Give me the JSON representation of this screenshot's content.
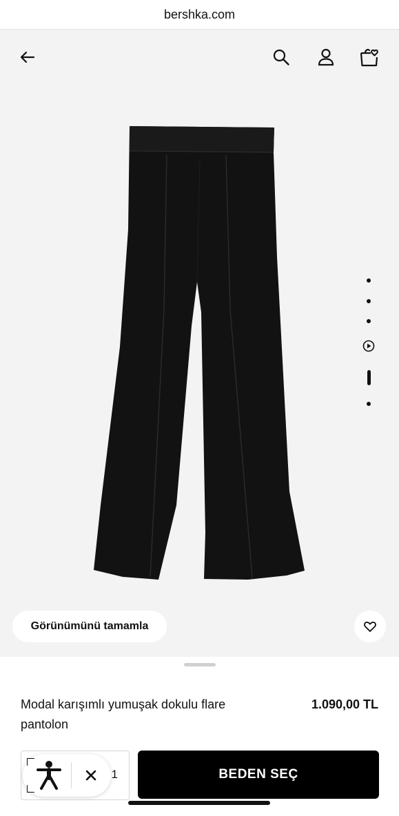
{
  "browser": {
    "url": "bershka.com"
  },
  "header": {
    "back_icon": "arrow-left-icon",
    "search_icon": "search-icon",
    "account_icon": "user-icon",
    "wishlist_bag_icon": "bag-heart-icon"
  },
  "gallery": {
    "image_count": 6,
    "active_index": 4,
    "has_video": true,
    "garment_color": "#121212"
  },
  "actions": {
    "complete_look_label": "Görünümünü tamamla",
    "favorite_icon": "heart-icon"
  },
  "product": {
    "name": "Modal karışımlı yumuşak dokulu flare pantolon",
    "price": "1.090,00 TL"
  },
  "purchase": {
    "quantity": "1",
    "select_size_label": "BEDEN SEÇ"
  },
  "accessibility_widget": {
    "icon": "accessibility-person-icon",
    "close_icon": "close-icon"
  },
  "colors": {
    "accent": "#000000",
    "stage_bg": "#f3f3f3"
  }
}
